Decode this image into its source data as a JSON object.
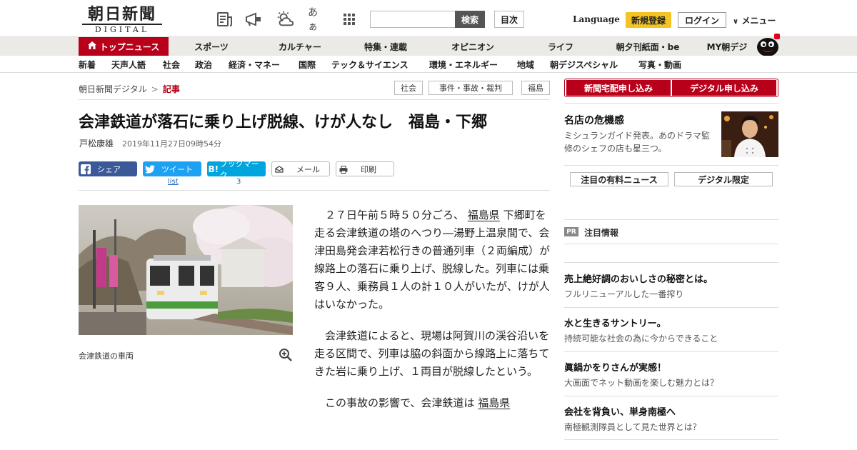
{
  "header": {
    "logo_main": "朝日新聞",
    "logo_sub": "DIGITAL",
    "search_button": "検索",
    "toc_button": "目次",
    "language": "Language",
    "register": "新規登録",
    "login": "ログイン",
    "menu": "メニュー",
    "icons": [
      "newspaper-icon",
      "megaphone-icon",
      "weather-icon",
      "font-size-icon",
      "grid-icon"
    ],
    "font_glyph": "あぁ"
  },
  "main_nav": [
    "トップニュース",
    "スポーツ",
    "カルチャー",
    "特集・連載",
    "オピニオン",
    "ライフ",
    "朝夕刊紙面・be",
    "MY朝デジ"
  ],
  "sub_nav": [
    "新着",
    "天声人語",
    "社会",
    "政治",
    "経済・マネー",
    "国際",
    "テック＆サイエンス",
    "環境・エネルギー",
    "地域",
    "朝デジスペシャル",
    "写真・動画"
  ],
  "breadcrumb": {
    "home": "朝日新聞デジタル",
    "separator": ">",
    "current": "記事"
  },
  "tags": [
    "社会",
    "事件・事故・裁判",
    "福島"
  ],
  "article": {
    "title": "会津鉄道が落石に乗り上げ脱線、けが人なし　福島・下郷",
    "author": "戸松康雄",
    "date": "2019年11月27日09時54分",
    "caption": "会津鉄道の車両",
    "p1_a": "２７日午前５時５０分ごろ、",
    "p1_link": "福島県",
    "p1_b": "下郷町を走る会津鉄道の塔のへつり―湯野上温泉間で、会津田島発会津若松行きの普通列車（２両編成）が線路上の落石に乗り上げ、脱線した。列車には乗客９人、乗務員１人の計１０人がいたが、けが人はいなかった。",
    "p2": "会津鉄道によると、現場は阿賀川の渓谷沿いを走る区間で、列車は脇の斜面から線路上に落ちてきた岩に乗り上げ、１両目が脱線したという。",
    "p3_a": "この事故の影響で、会津鉄道は",
    "p3_link": "福島県"
  },
  "share": {
    "facebook": "シェア",
    "twitter": "ツイート",
    "hatena": "ブックマーク",
    "hatena_icon": "B!",
    "mail": "メール",
    "print": "印刷",
    "twitter_count": "list",
    "hatena_count": "3"
  },
  "sidebar": {
    "subscribe_paper": "新聞宅配申し込み",
    "subscribe_digital": "デジタル申し込み",
    "feature_title": "名店の危機感",
    "feature_text": "ミシュランガイド発表。あのドラマ監修のシェフの店も星三つ。",
    "tab_premium": "注目の有料ニュース",
    "tab_digital": "デジタル限定",
    "pr_badge": "PR",
    "pr_title": "注目情報",
    "ads": [
      {
        "title": "売上絶好調のおいしさの秘密とは。",
        "text": "フルリニューアルした一番搾り"
      },
      {
        "title": "水と生きるサントリー。",
        "text": "持続可能な社会の為に今からできること"
      },
      {
        "title": "眞鍋かをりさんが実感！",
        "text": "大画面でネット動画を楽しむ魅力とは？"
      },
      {
        "title": "会社を背負い、単身南極へ",
        "text": "南極観測隊員として見た世界とは？"
      }
    ]
  },
  "colors": {
    "brand_red": "#b8001a",
    "register_yellow": "#f4c324",
    "facebook": "#3b5998",
    "twitter": "#1da1f2",
    "hatena": "#00a4de"
  }
}
